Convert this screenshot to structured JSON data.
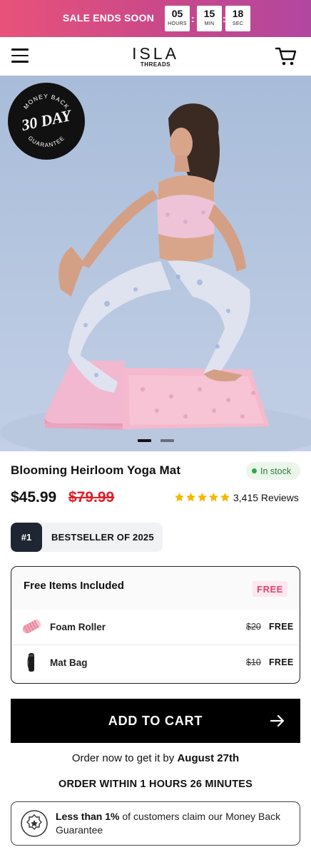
{
  "sale_bar": {
    "label": "SALE ENDS SOON",
    "hours": "05",
    "hours_unit": "HOURS",
    "minutes": "15",
    "minutes_unit": "MIN",
    "seconds": "18",
    "seconds_unit": "SEC",
    "separator": ":"
  },
  "header": {
    "brand_line1": "ISLA",
    "brand_line2": "THREADS"
  },
  "hero": {
    "badge_top": "MONEY BACK",
    "badge_main": "30 DAY",
    "badge_bottom": "GUARANTEE",
    "carousel_count": 2,
    "carousel_active": 0
  },
  "product": {
    "title": "Blooming Heirloom Yoga Mat",
    "stock": "In stock",
    "price": "$45.99",
    "old_price": "$79.99",
    "rating": 5,
    "reviews": "3,415 Reviews",
    "rank": "#1",
    "rank_label": "BESTSELLER OF 2025"
  },
  "free_items": {
    "heading": "Free Items Included",
    "tag": "FREE",
    "items": [
      {
        "name": "Foam Roller",
        "was": "$20",
        "now": "FREE"
      },
      {
        "name": "Mat Bag",
        "was": "$10",
        "now": "FREE"
      }
    ]
  },
  "cta": {
    "label": "ADD TO CART",
    "delivery_prefix": "Order now to get it by ",
    "delivery_date": "August 27th",
    "order_within": "ORDER WITHIN 1 HOURS 26 MINUTES"
  },
  "guarantee": {
    "bold": "Less than 1%",
    "rest": " of customers claim our Money Back Guarantee"
  },
  "colors": {
    "accent_pink": "#e8527a",
    "accent_purple": "#b247a0",
    "star": "#f5b800",
    "sale_red": "#e0202a",
    "stock_green": "#2aa94a"
  },
  "icons": [
    "menu-icon",
    "cart-icon",
    "arrow-right-icon",
    "foam-roller-icon",
    "mat-bag-icon",
    "guarantee-seal-icon",
    "star-icon"
  ]
}
